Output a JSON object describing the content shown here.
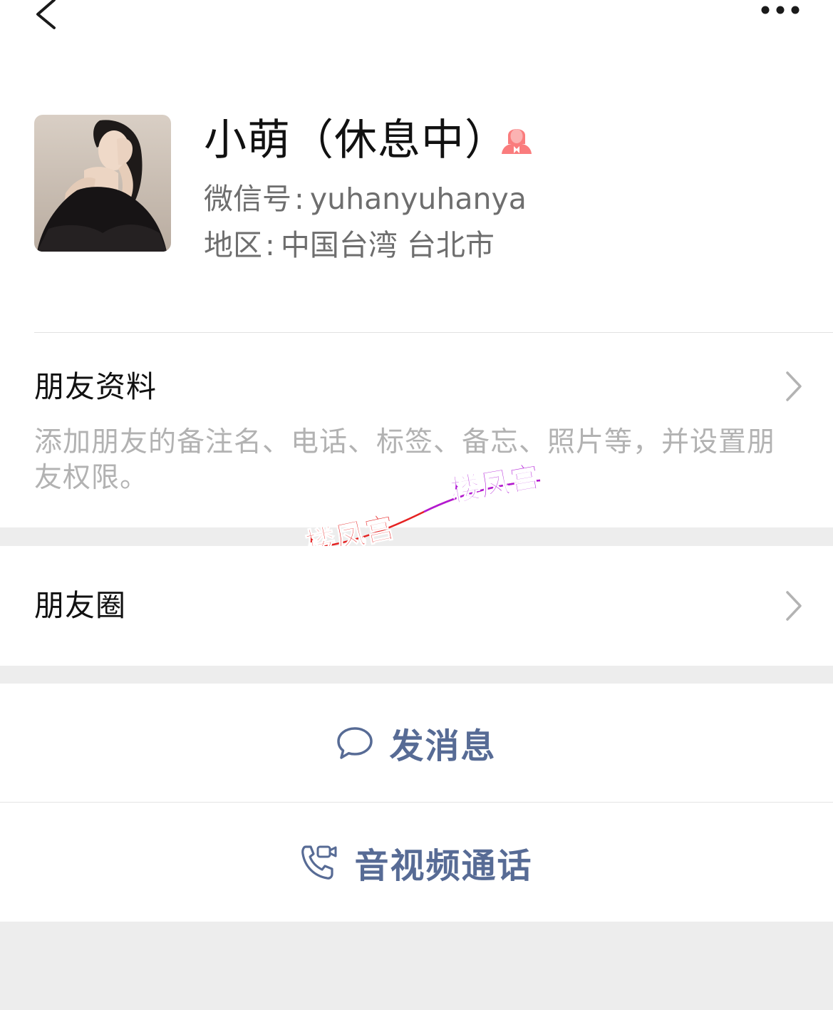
{
  "header": {
    "back_icon": "chevron-left-icon",
    "more_icon": "more-dots-icon"
  },
  "profile": {
    "avatar": "profile-photo",
    "name": "小萌（休息中）",
    "gender_icon": "female-person-icon",
    "gender_color": "#fa7c7d",
    "wechat_id_label": "微信号",
    "wechat_id": "yuhanyuhanya",
    "region_label": "地区",
    "region": "中国台湾 台北市"
  },
  "friend_info": {
    "title": "朋友资料",
    "description": "添加朋友的备注名、电话、标签、备忘、照片等，并设置朋友权限。"
  },
  "watermark": {
    "text_1": "楼凤宫",
    "text_2": "楼凤宫"
  },
  "moments": {
    "title": "朋友圈"
  },
  "actions": {
    "message": "发消息",
    "call": "音视频通话",
    "color": "#576b95"
  }
}
